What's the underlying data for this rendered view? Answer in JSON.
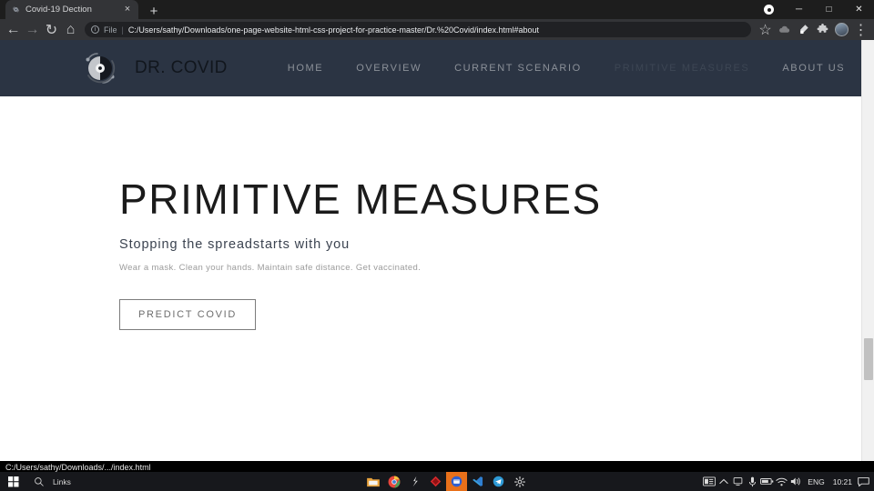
{
  "browser": {
    "tab": {
      "title": "Covid-19 Dection",
      "favicon": "virus-favicon",
      "close_label": "×"
    },
    "new_tab_label": "+",
    "window": {
      "profile_indicator": "profile-status-dot",
      "minimize_label": "─",
      "maximize_label": "□",
      "close_label": "✕"
    },
    "toolbar": {
      "back_label": "←",
      "forward_label": "→",
      "reload_label": "↻",
      "home_label": "⌂",
      "omnibox": {
        "info_label": "i",
        "scheme_label": "File",
        "separator": "|",
        "url": "C:/Users/sathy/Downloads/one-page-website-html-css-project-for-practice-master/Dr.%20Covid/index.html#about"
      },
      "bookmark_label": "☆",
      "extensions_label": "❖",
      "menu_label": "⋮"
    }
  },
  "page": {
    "header": {
      "logo_name": "virus-logo",
      "brand": "DR. COVID",
      "nav": [
        {
          "label": "HOME",
          "active": false
        },
        {
          "label": "OVERVIEW",
          "active": false
        },
        {
          "label": "CURRENT SCENARIO",
          "active": false
        },
        {
          "label": "PRIMITIVE MEASURES",
          "active": true
        },
        {
          "label": "ABOUT US",
          "active": false
        }
      ]
    },
    "hero": {
      "title": "PRIMITIVE MEASURES",
      "subtitle": "Stopping the spreadstarts with you",
      "description": "Wear a mask. Clean your hands. Maintain safe distance. Get vaccinated.",
      "cta_label": "PREDICT COVID"
    },
    "colors": {
      "header_bg": "#2b3443",
      "page_bg": "#ffffff",
      "nav_link": "#8c9199",
      "nav_active": "#3d4654",
      "heading": "#1b1b1b"
    }
  },
  "status_bar": {
    "text": "C:/Users/sathy/Downloads/.../index.html"
  },
  "taskbar": {
    "start_label": "windows-start",
    "search_label": "search-icon",
    "links_label": "Links",
    "apps": [
      {
        "name": "file-explorer",
        "active": false
      },
      {
        "name": "google-chrome",
        "active": false
      },
      {
        "name": "powershell",
        "active": false
      },
      {
        "name": "red-diamond-app",
        "active": false
      },
      {
        "name": "orange-browser-app",
        "active": true
      },
      {
        "name": "vs-code",
        "active": false
      },
      {
        "name": "telegram",
        "active": false
      },
      {
        "name": "settings-gear",
        "active": false
      }
    ],
    "tray": {
      "icons": [
        "keyboard-icon",
        "chevron-up-icon",
        "display-icon",
        "microphone-icon",
        "battery-icon",
        "wifi-icon",
        "volume-icon"
      ],
      "language": "ENG",
      "time": "10:21",
      "action_center": "notification-icon"
    }
  }
}
